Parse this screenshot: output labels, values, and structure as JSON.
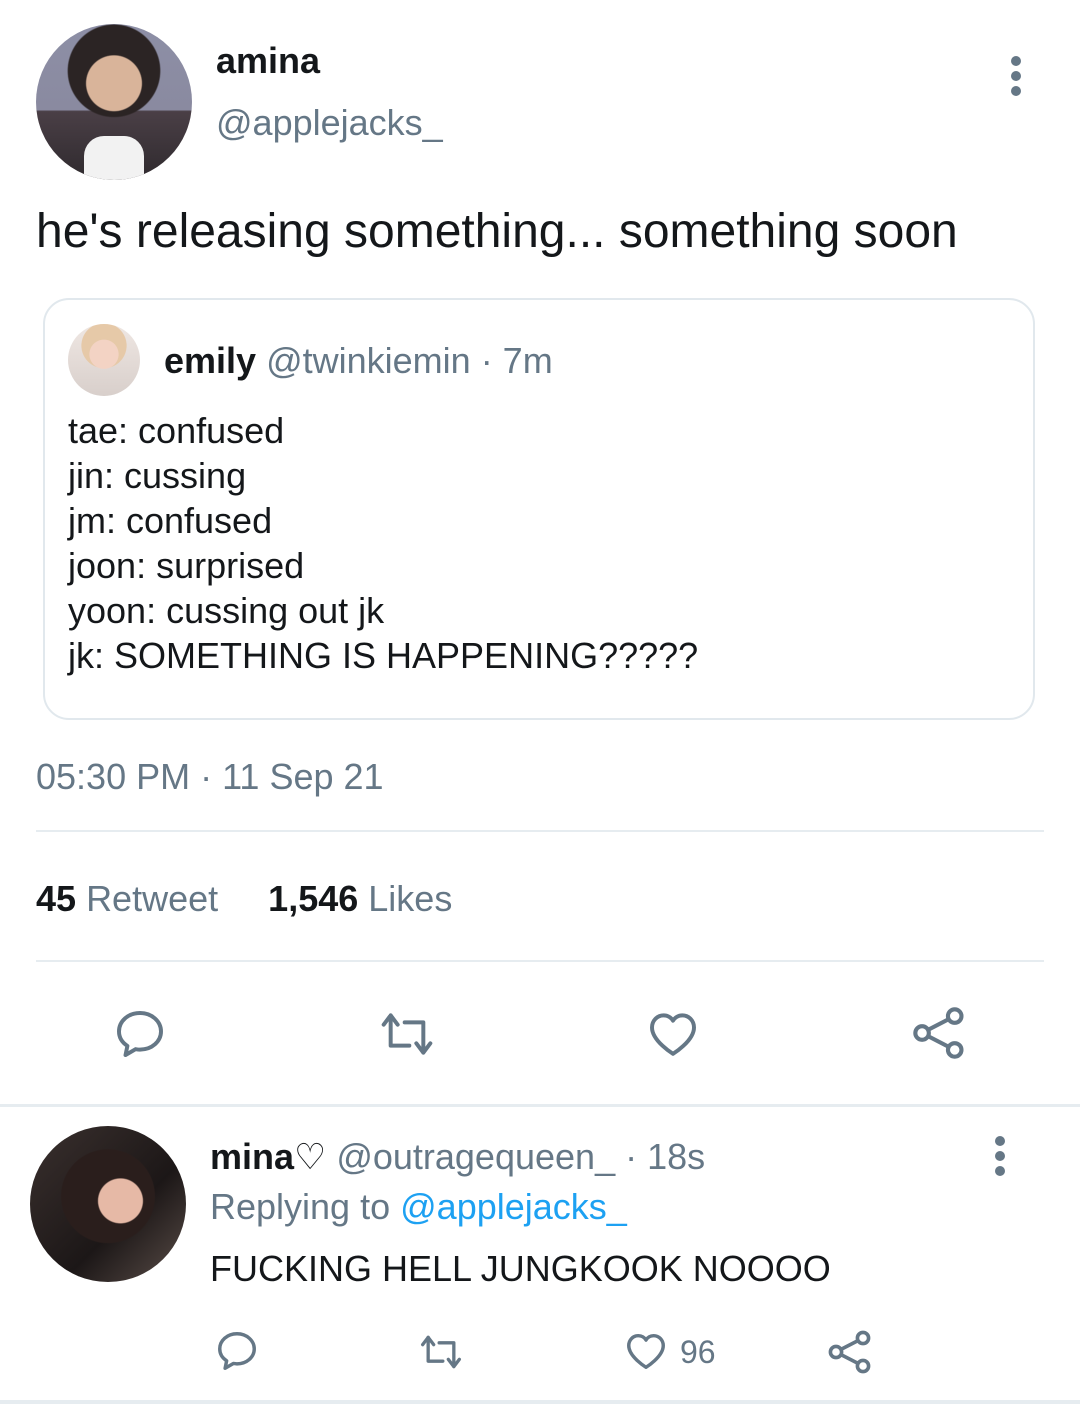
{
  "tweet": {
    "display_name": "amina",
    "handle": "@applejacks_",
    "text": "he's releasing something... something soon",
    "timestamp": "05:30 PM · 11 Sep 21",
    "retweet_count": "45",
    "retweet_label": "Retweet",
    "like_count": "1,546",
    "like_label": "Likes"
  },
  "quote": {
    "display_name": "emily",
    "handle": "@twinkiemin",
    "time": "· 7m",
    "lines": [
      "tae: confused",
      "jin: cussing",
      "jm: confused",
      "joon: surprised",
      "yoon: cussing out jk",
      "jk: SOMETHING IS HAPPENING?????"
    ]
  },
  "reply": {
    "display_name": "mina♡",
    "handle": "@outragequeen_",
    "time": "· 18s",
    "replying_prefix": "Replying to",
    "replying_handle": "@applejacks_",
    "text": "FUCKING HELL JUNGKOOK NOOOO",
    "like_count": "96"
  },
  "icons": {
    "reply": "reply-icon",
    "retweet": "retweet-icon",
    "like": "heart-icon",
    "share": "share-icon",
    "more": "more-vertical-icon"
  },
  "colors": {
    "text": "#14171a",
    "muted": "#657786",
    "link": "#1da1f2",
    "border": "#e1e8ed"
  }
}
